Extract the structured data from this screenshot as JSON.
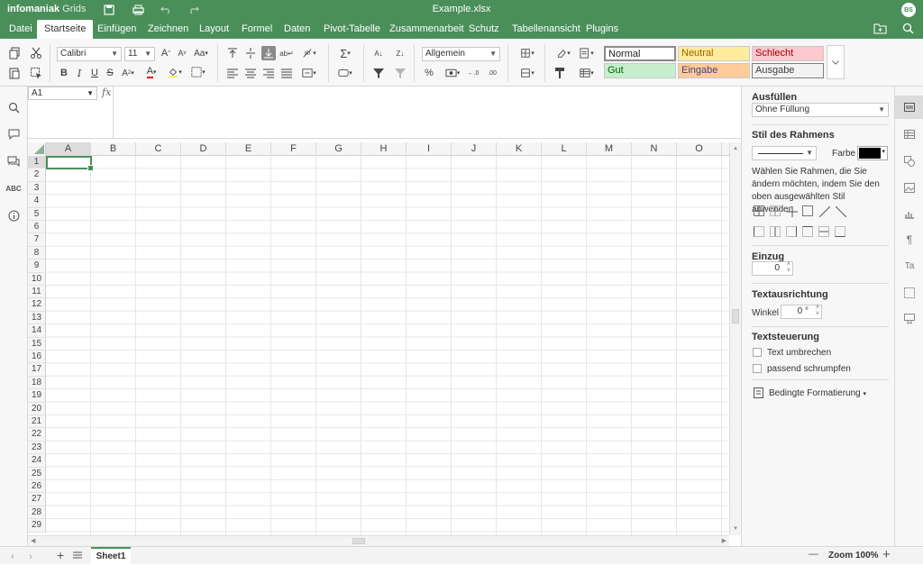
{
  "app": {
    "brand_bold": "infomaniak",
    "brand_product": "Grids",
    "doc_title": "Example.xlsx",
    "avatar_initials": "BS",
    "accent": "#4a8f5a"
  },
  "menu": {
    "tabs": [
      "Datei",
      "Startseite",
      "Einfügen",
      "Zeichnen",
      "Layout",
      "Formel",
      "Daten",
      "Pivot-Tabelle",
      "Zusammenarbeit",
      "Schutz",
      "Tabellenansicht",
      "Plugins"
    ],
    "active": "Startseite"
  },
  "toolbar": {
    "font_name": "Calibri",
    "font_size": "11",
    "number_format": "Allgemein",
    "styles": {
      "normal": "Normal",
      "neutral": "Neutral",
      "schlecht": "Schlecht",
      "gut": "Gut",
      "eingabe": "Eingabe",
      "ausgabe": "Ausgabe"
    },
    "style_colors": {
      "neutral_bg": "#ffeb9c",
      "neutral_fg": "#9c6500",
      "schlecht_bg": "#ffc7ce",
      "schlecht_fg": "#9c0006",
      "gut_bg": "#c6efce",
      "gut_fg": "#006100",
      "eingabe_bg": "#ffcc99",
      "eingabe_fg": "#3f3f76"
    },
    "bold": "B",
    "italic": "I",
    "underline": "U",
    "strike": "S",
    "font_color_letter": "A"
  },
  "formula": {
    "cell_ref": "A1",
    "fx": "fx"
  },
  "grid": {
    "columns": [
      "A",
      "B",
      "C",
      "D",
      "E",
      "F",
      "G",
      "H",
      "I",
      "J",
      "K",
      "L",
      "M",
      "N",
      "O"
    ],
    "rows": [
      "1",
      "2",
      "3",
      "4",
      "5",
      "6",
      "7",
      "8",
      "9",
      "10",
      "11",
      "12",
      "13",
      "14",
      "15",
      "16",
      "17",
      "18",
      "19",
      "20",
      "21",
      "22",
      "23",
      "24",
      "25",
      "26",
      "27",
      "28",
      "29"
    ],
    "selected_col": "A",
    "selected_row": "1"
  },
  "panel": {
    "fill_title": "Ausfüllen",
    "fill_value": "Ohne Füllung",
    "border_title": "Stil des Rahmens",
    "color_label": "Farbe",
    "border_hint": "Wählen Sie Rahmen, die Sie ändern möchten, indem Sie den oben ausgewählten Stil anwenden",
    "indent_title": "Einzug",
    "indent_value": "0",
    "align_title": "Textausrichtung",
    "angle_label": "Winkel",
    "angle_value": "0 °",
    "textctrl_title": "Textsteuerung",
    "wrap_label": "Text umbrechen",
    "shrink_label": "passend schrumpfen",
    "cond_format": "Bedingte Formatierung"
  },
  "status": {
    "sheet_name": "Sheet1",
    "zoom": "Zoom 100%",
    "minus": "—",
    "plus": "+"
  }
}
